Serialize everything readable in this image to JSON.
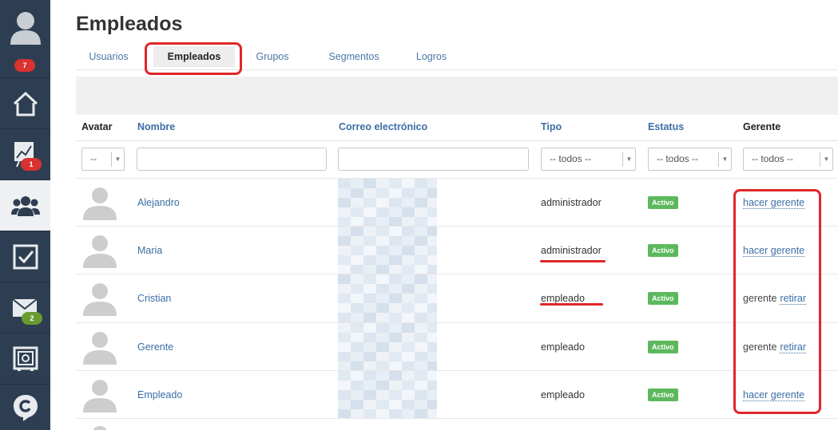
{
  "sidebar": {
    "notifications_badge": "7",
    "reports_badge": "1",
    "mail_badge": "2"
  },
  "header": {
    "title": "Empleados"
  },
  "tabs": [
    {
      "label": "Usuarios"
    },
    {
      "label": "Empleados"
    },
    {
      "label": "Grupos"
    },
    {
      "label": "Segmentos"
    },
    {
      "label": "Logros"
    }
  ],
  "table": {
    "headers": {
      "avatar": "Avatar",
      "nombre": "Nombre",
      "correo": "Correo electrónico",
      "tipo": "Tipo",
      "estatus": "Estatus",
      "gerente": "Gerente"
    },
    "filters": {
      "avatar": "--",
      "tipo": "-- todos --",
      "estatus": "-- todos --",
      "gerente": "-- todos --"
    },
    "rows": [
      {
        "nombre": "Alejandro",
        "tipo": "administrador",
        "estatus": "Activo",
        "gerente_text": "",
        "gerente_link": "hacer gerente"
      },
      {
        "nombre": "Maria",
        "tipo": "administrador",
        "estatus": "Activo",
        "gerente_text": "",
        "gerente_link": "hacer gerente"
      },
      {
        "nombre": "Cristian",
        "tipo": "empleado",
        "estatus": "Activo",
        "gerente_text": "gerente",
        "gerente_link": "retirar"
      },
      {
        "nombre": "Gerente",
        "tipo": "empleado",
        "estatus": "Activo",
        "gerente_text": "gerente",
        "gerente_link": "retirar"
      },
      {
        "nombre": "Empleado",
        "tipo": "empleado",
        "estatus": "Activo",
        "gerente_text": "",
        "gerente_link": "hacer gerente"
      }
    ]
  },
  "colors": {
    "sidebar": "#2e3e52",
    "accent_link": "#3b6ea5",
    "status_active": "#5cb85c",
    "highlight": "#e0262a"
  }
}
